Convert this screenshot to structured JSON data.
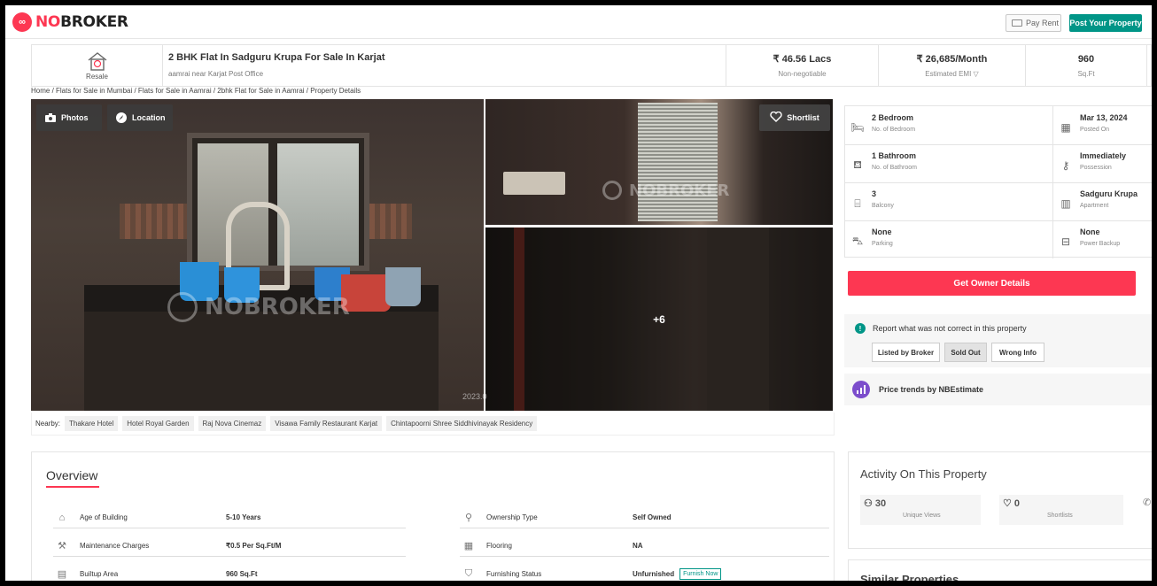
{
  "header": {
    "logo_text_no": "NO",
    "logo_text_rest": "BROKER",
    "pay_rent": "Pay Rent",
    "post_property": "Post Your Property"
  },
  "summary": {
    "resale": "Resale",
    "title": "2 BHK Flat In Sadguru Krupa For Sale In Karjat",
    "location": "aamrai near Karjat Post Office",
    "price": "₹ 46.56 Lacs",
    "price_note": "Non-negotiable",
    "emi": "₹ 26,685/Month",
    "emi_note": "Estimated EMI ▽",
    "area": "960",
    "area_unit": "Sq.Ft"
  },
  "breadcrumb": "Home / Flats for Sale in Mumbai / Flats for Sale in Aamrai / 2bhk Flat for Sale in Aamrai / Property Details",
  "gallery": {
    "photos": "Photos",
    "location": "Location",
    "shortlist": "Shortlist",
    "more": "+6",
    "watermark": "NOBROKER",
    "stamp": "2023.0"
  },
  "nearby": {
    "label": "Nearby:",
    "places": [
      "Thakare Hotel",
      "Hotel Royal Garden",
      "Raj Nova Cinemaz",
      "Visawa Family Restaurant Karjat",
      "Chintapoorni Shree Siddhivinayak Residency"
    ]
  },
  "facts": [
    {
      "title": "2 Bedroom",
      "sub": "No. of Bedroom",
      "icon": "bed-icon"
    },
    {
      "title": "Mar 13, 2024",
      "sub": "Posted On",
      "icon": "calendar-icon"
    },
    {
      "title": "1 Bathroom",
      "sub": "No. of Bathroom",
      "icon": "bath-icon"
    },
    {
      "title": "Immediately",
      "sub": "Possession",
      "icon": "key-icon"
    },
    {
      "title": "3",
      "sub": "Balcony",
      "icon": "balcony-icon"
    },
    {
      "title": "Sadguru Krupa",
      "sub": "Apartment",
      "icon": "building-icon"
    },
    {
      "title": "None",
      "sub": "Parking",
      "icon": "car-icon"
    },
    {
      "title": "None",
      "sub": "Power Backup",
      "icon": "battery-icon"
    }
  ],
  "owner_button": "Get Owner Details",
  "report": {
    "text": "Report what was not correct in this property",
    "options": [
      "Listed by Broker",
      "Sold Out",
      "Wrong Info"
    ]
  },
  "trends": "Price trends by NBEstimate",
  "overview": {
    "title": "Overview",
    "rows": [
      {
        "label": "Age of Building",
        "value": "5-10 Years"
      },
      {
        "label": "Ownership Type",
        "value": "Self Owned"
      },
      {
        "label": "Maintenance Charges",
        "value": "₹0.5 Per Sq.Ft/M"
      },
      {
        "label": "Flooring",
        "value": "NA"
      },
      {
        "label": "Builtup Area",
        "value": "960 Sq.Ft"
      },
      {
        "label": "Furnishing Status",
        "value": "Unfurnished"
      }
    ],
    "furnish_now": "Furnish Now"
  },
  "activity": {
    "title": "Activity On This Property",
    "views": "30",
    "views_label": "Unique Views",
    "shortlists": "0",
    "shortlists_label": "Shortlists"
  },
  "similar": "Similar Properties",
  "colors": {
    "brand": "#fd3752",
    "accent": "#009587"
  }
}
